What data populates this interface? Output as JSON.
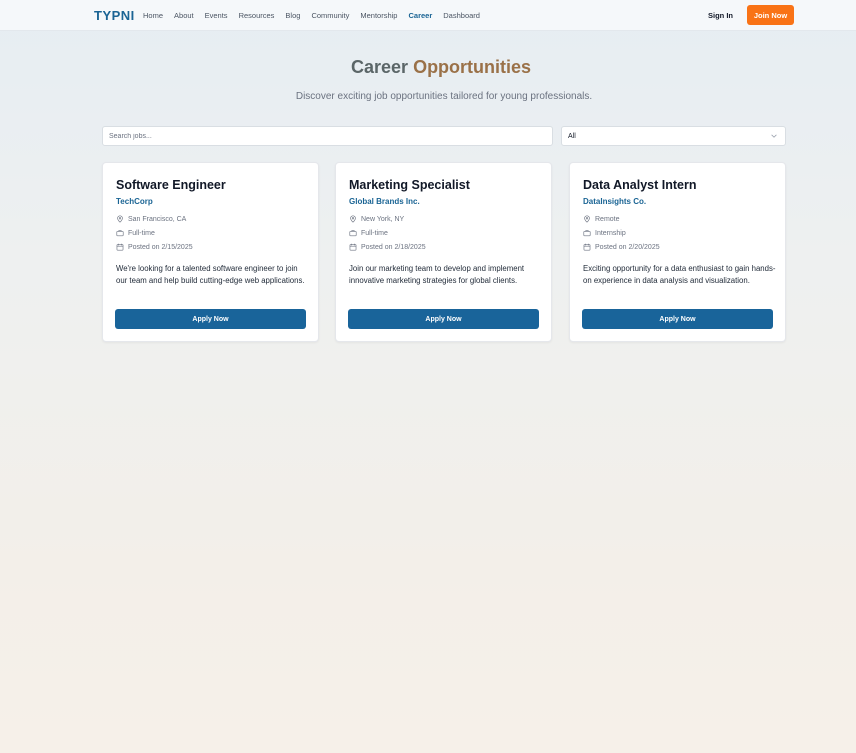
{
  "nav": {
    "logo": "TYPNI",
    "links": [
      "Home",
      "About",
      "Events",
      "Resources",
      "Blog",
      "Community",
      "Mentorship",
      "Career",
      "Dashboard"
    ],
    "active": "Career",
    "sign_in": "Sign In",
    "join": "Join Now"
  },
  "hero": {
    "title_part1": "Career",
    "title_part2": "Opportunities",
    "subtitle": "Discover exciting job opportunities tailored for young professionals."
  },
  "filters": {
    "search_placeholder": "Search jobs...",
    "select_value": "All"
  },
  "jobs": [
    {
      "title": "Software Engineer",
      "company": "TechCorp",
      "location": "San Francisco, CA",
      "type": "Full-time",
      "posted": "Posted on 2/15/2025",
      "description": "We're looking for a talented software engineer to join our team and help build cutting-edge web applications.",
      "apply": "Apply Now"
    },
    {
      "title": "Marketing Specialist",
      "company": "Global Brands Inc.",
      "location": "New York, NY",
      "type": "Full-time",
      "posted": "Posted on 2/18/2025",
      "description": "Join our marketing team to develop and implement innovative marketing strategies for global clients.",
      "apply": "Apply Now"
    },
    {
      "title": "Data Analyst Intern",
      "company": "DataInsights Co.",
      "location": "Remote",
      "type": "Internship",
      "posted": "Posted on 2/20/2025",
      "description": "Exciting opportunity for a data enthusiast to gain hands-on experience in data analysis and visualization.",
      "apply": "Apply Now"
    }
  ],
  "colors": {
    "brand": "#1a6494",
    "accent": "#f97316",
    "apply_button": "#19649a"
  }
}
